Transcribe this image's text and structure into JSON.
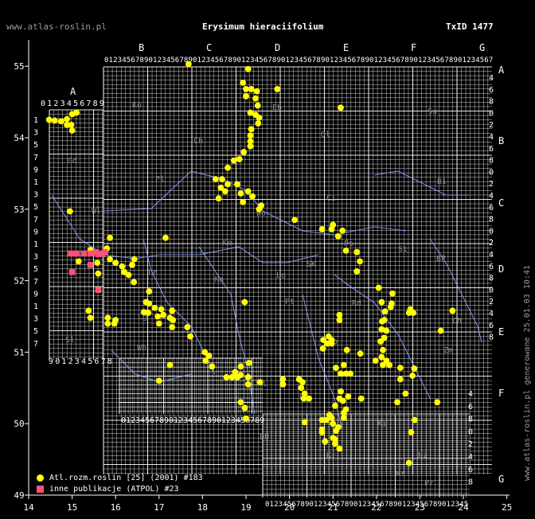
{
  "header": {
    "site": "www.atlas-roslin.pl",
    "species": "Erysimum hieraciifolium",
    "taxon_id": "TxID 1477"
  },
  "credit": "www.atlas-roslin.pl generowane 25.01.03 10:41",
  "colors": {
    "background": "#000000",
    "grid": "#ffffff",
    "river": "#8ca0ff",
    "region_label": "#8c8c8c",
    "atlas_point": "#ffff00",
    "other_point": "#ff5078"
  },
  "axes": {
    "x_ticks": [
      "14",
      "15",
      "16",
      "17",
      "18",
      "19",
      "20",
      "21",
      "22",
      "23",
      "24",
      "25"
    ],
    "y_ticks": [
      "49",
      "50",
      "51",
      "52",
      "53",
      "54",
      "55"
    ]
  },
  "grid_labels": {
    "column_letters": [
      "A",
      "B",
      "C",
      "D",
      "E",
      "F",
      "G"
    ],
    "row_letters": [
      "A",
      "B",
      "C",
      "D",
      "E",
      "F",
      "G"
    ],
    "digit_run": "0123456789"
  },
  "regions": [
    "Ko",
    "Eb",
    "Su",
    "Ol",
    "Gd",
    "Ch",
    "Pl",
    "Ci",
    "Bi",
    "Wl",
    "Wo",
    "Ps",
    "Si",
    "BP",
    "Ko",
    "Le",
    "Ka",
    "Lo",
    "SK",
    "Pt",
    "Rd",
    "Lg",
    "Lb",
    "Ch",
    "Zm",
    "Wb",
    "Sl",
    "Kl",
    "Rz",
    "Ki",
    "BB",
    "Kr",
    "Ni",
    "Kr",
    "Pr"
  ],
  "legend": {
    "atlas_label": "Atl.rozm.roslin [25] (2001) #183",
    "other_label": "inne publikacje (ATPOL) #23"
  },
  "chart_data": {
    "type": "scatter",
    "xlim": [
      14,
      25
    ],
    "ylim": [
      49,
      55.4
    ],
    "series": [
      {
        "name": "Atl.rozm.roslin [25] (2001) #183",
        "points": [
          [
            14.47,
            54.25
          ],
          [
            14.6,
            54.24
          ],
          [
            14.75,
            54.23
          ],
          [
            14.88,
            54.26
          ],
          [
            15.0,
            54.33
          ],
          [
            15.1,
            54.35
          ],
          [
            14.88,
            54.18
          ],
          [
            14.98,
            54.18
          ],
          [
            15.0,
            54.1
          ],
          [
            14.95,
            52.97
          ],
          [
            17.68,
            55.03
          ],
          [
            19.05,
            54.96
          ],
          [
            19.72,
            54.68
          ],
          [
            18.93,
            54.77
          ],
          [
            19.0,
            54.68
          ],
          [
            19.12,
            54.68
          ],
          [
            19.25,
            54.65
          ],
          [
            19.0,
            54.58
          ],
          [
            19.22,
            54.55
          ],
          [
            19.27,
            54.45
          ],
          [
            19.1,
            54.35
          ],
          [
            19.22,
            54.32
          ],
          [
            19.3,
            54.28
          ],
          [
            19.28,
            54.2
          ],
          [
            19.12,
            54.12
          ],
          [
            19.1,
            54.03
          ],
          [
            19.1,
            53.95
          ],
          [
            19.1,
            53.88
          ],
          [
            18.95,
            53.8
          ],
          [
            18.85,
            53.7
          ],
          [
            18.72,
            53.68
          ],
          [
            18.58,
            53.58
          ],
          [
            18.3,
            53.42
          ],
          [
            18.45,
            53.42
          ],
          [
            18.58,
            53.35
          ],
          [
            18.42,
            53.3
          ],
          [
            18.52,
            53.25
          ],
          [
            18.8,
            53.35
          ],
          [
            18.88,
            53.22
          ],
          [
            19.05,
            53.25
          ],
          [
            18.93,
            53.1
          ],
          [
            18.37,
            53.15
          ],
          [
            19.15,
            53.18
          ],
          [
            19.35,
            53.05
          ],
          [
            21.18,
            54.42
          ],
          [
            19.3,
            53.0
          ],
          [
            20.12,
            52.85
          ],
          [
            21.0,
            52.78
          ],
          [
            20.75,
            52.72
          ],
          [
            20.97,
            52.72
          ],
          [
            21.12,
            52.62
          ],
          [
            21.22,
            52.7
          ],
          [
            21.3,
            52.42
          ],
          [
            21.55,
            52.4
          ],
          [
            21.62,
            52.27
          ],
          [
            21.55,
            52.13
          ],
          [
            16.43,
            52.3
          ],
          [
            16.3,
            52.08
          ],
          [
            16.2,
            52.12
          ],
          [
            16.38,
            52.22
          ],
          [
            15.87,
            52.6
          ],
          [
            15.8,
            52.45
          ],
          [
            15.42,
            52.43
          ],
          [
            15.58,
            52.25
          ],
          [
            15.6,
            52.1
          ],
          [
            16.42,
            51.98
          ],
          [
            17.15,
            52.6
          ],
          [
            15.15,
            52.27
          ],
          [
            16.0,
            52.25
          ],
          [
            16.15,
            52.2
          ],
          [
            15.87,
            52.3
          ],
          [
            18.97,
            51.7
          ],
          [
            16.77,
            51.85
          ],
          [
            16.7,
            51.7
          ],
          [
            16.9,
            51.62
          ],
          [
            16.75,
            51.55
          ],
          [
            16.97,
            51.5
          ],
          [
            17.1,
            51.52
          ],
          [
            17.05,
            51.6
          ],
          [
            17.3,
            51.58
          ],
          [
            17.25,
            51.48
          ],
          [
            17.0,
            51.4
          ],
          [
            17.3,
            51.35
          ],
          [
            17.32,
            51.45
          ],
          [
            17.65,
            51.35
          ],
          [
            17.72,
            51.22
          ],
          [
            18.05,
            51.0
          ],
          [
            18.15,
            50.95
          ],
          [
            18.07,
            50.88
          ],
          [
            18.22,
            50.8
          ],
          [
            15.38,
            51.58
          ],
          [
            15.42,
            51.48
          ],
          [
            15.82,
            51.48
          ],
          [
            15.82,
            51.4
          ],
          [
            15.97,
            51.4
          ],
          [
            16.0,
            51.45
          ],
          [
            16.65,
            51.56
          ],
          [
            16.77,
            51.68
          ],
          [
            17.25,
            50.82
          ],
          [
            17.0,
            50.6
          ],
          [
            18.55,
            50.65
          ],
          [
            18.68,
            50.65
          ],
          [
            18.75,
            50.72
          ],
          [
            18.88,
            50.68
          ],
          [
            18.88,
            50.8
          ],
          [
            19.07,
            50.85
          ],
          [
            18.8,
            50.65
          ],
          [
            19.05,
            50.65
          ],
          [
            19.05,
            50.55
          ],
          [
            18.88,
            50.3
          ],
          [
            18.97,
            50.22
          ],
          [
            19.0,
            50.07
          ],
          [
            19.32,
            50.58
          ],
          [
            19.85,
            50.62
          ],
          [
            19.85,
            50.55
          ],
          [
            20.22,
            50.62
          ],
          [
            20.3,
            50.58
          ],
          [
            20.27,
            50.5
          ],
          [
            20.35,
            50.42
          ],
          [
            20.45,
            50.35
          ],
          [
            20.33,
            50.35
          ],
          [
            20.35,
            50.02
          ],
          [
            20.75,
            50.05
          ],
          [
            20.85,
            50.05
          ],
          [
            20.75,
            49.92
          ],
          [
            20.75,
            49.88
          ],
          [
            20.82,
            49.75
          ],
          [
            21.05,
            49.78
          ],
          [
            21.07,
            49.9
          ],
          [
            21.12,
            49.95
          ],
          [
            21.0,
            50.0
          ],
          [
            20.92,
            50.12
          ],
          [
            20.97,
            50.08
          ],
          [
            21.0,
            49.8
          ],
          [
            21.05,
            49.72
          ],
          [
            21.15,
            49.65
          ],
          [
            21.25,
            50.08
          ],
          [
            21.25,
            50.15
          ],
          [
            21.3,
            50.2
          ],
          [
            21.23,
            50.32
          ],
          [
            21.18,
            50.45
          ],
          [
            21.05,
            50.25
          ],
          [
            21.15,
            50.35
          ],
          [
            21.35,
            50.38
          ],
          [
            21.4,
            50.7
          ],
          [
            21.18,
            50.7
          ],
          [
            21.3,
            50.7
          ],
          [
            21.07,
            50.78
          ],
          [
            21.25,
            50.82
          ],
          [
            20.77,
            51.05
          ],
          [
            20.87,
            51.12
          ],
          [
            20.97,
            51.12
          ],
          [
            20.78,
            51.17
          ],
          [
            20.9,
            51.22
          ],
          [
            20.97,
            51.17
          ],
          [
            21.15,
            51.52
          ],
          [
            21.15,
            51.45
          ],
          [
            21.32,
            51.03
          ],
          [
            21.63,
            50.98
          ],
          [
            21.65,
            50.35
          ],
          [
            21.98,
            50.88
          ],
          [
            22.12,
            50.93
          ],
          [
            22.23,
            50.88
          ],
          [
            22.3,
            50.82
          ],
          [
            22.1,
            51.15
          ],
          [
            22.18,
            51.2
          ],
          [
            22.15,
            51.03
          ],
          [
            22.12,
            51.32
          ],
          [
            22.13,
            51.43
          ],
          [
            22.23,
            51.3
          ],
          [
            22.18,
            51.45
          ],
          [
            22.2,
            51.57
          ],
          [
            22.12,
            51.7
          ],
          [
            22.35,
            51.68
          ],
          [
            22.37,
            51.82
          ],
          [
            22.33,
            51.63
          ],
          [
            22.05,
            51.9
          ],
          [
            22.75,
            51.55
          ],
          [
            22.85,
            51.55
          ],
          [
            22.78,
            51.6
          ],
          [
            23.48,
            51.3
          ],
          [
            23.75,
            51.58
          ],
          [
            22.55,
            50.78
          ],
          [
            22.67,
            50.42
          ],
          [
            22.87,
            50.77
          ],
          [
            22.88,
            50.05
          ],
          [
            22.8,
            49.88
          ],
          [
            22.75,
            49.45
          ],
          [
            23.4,
            50.3
          ],
          [
            22.55,
            50.62
          ],
          [
            22.83,
            50.67
          ],
          [
            22.48,
            50.3
          ],
          [
            22.15,
            50.82
          ]
        ]
      },
      {
        "name": "inne publikacje (ATPOL) #23",
        "points": [
          [
            14.97,
            52.38
          ],
          [
            15.1,
            52.38
          ],
          [
            15.27,
            52.38
          ],
          [
            15.42,
            52.38
          ],
          [
            15.55,
            52.4
          ],
          [
            15.6,
            52.37
          ],
          [
            15.7,
            52.38
          ],
          [
            15.75,
            52.4
          ],
          [
            15.42,
            52.22
          ],
          [
            15.0,
            52.12
          ],
          [
            15.6,
            51.87
          ]
        ]
      }
    ]
  }
}
